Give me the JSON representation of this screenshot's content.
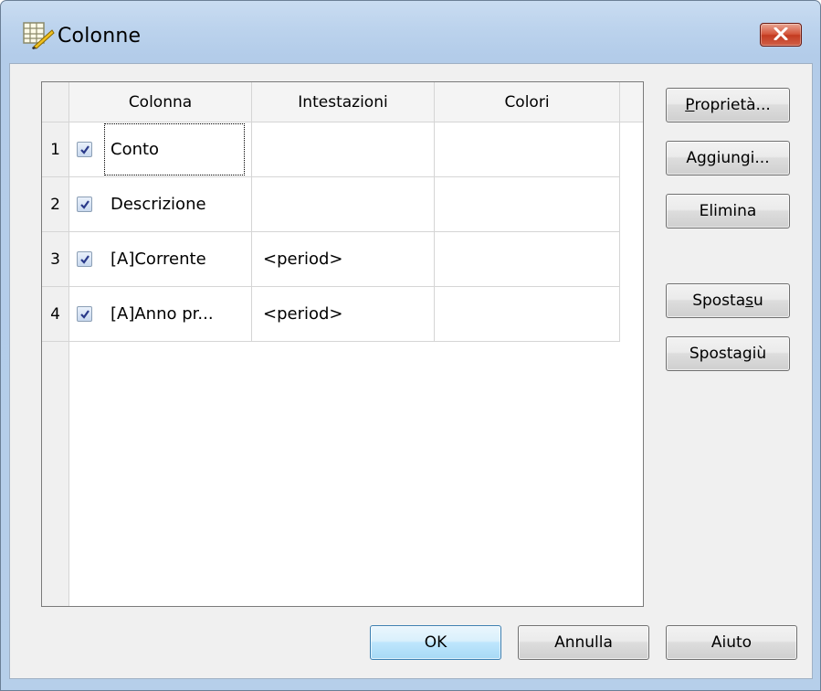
{
  "window": {
    "title": "Colonne"
  },
  "icons": {
    "app": "columns-app-icon",
    "close": "close-icon",
    "check": "checkmark-icon"
  },
  "grid": {
    "columns": [
      "Colonna",
      "Intestazioni",
      "Colori"
    ],
    "rows": [
      {
        "num": "1",
        "checked": true,
        "colonna": "Conto",
        "intestazioni": "",
        "colori": ""
      },
      {
        "num": "2",
        "checked": true,
        "colonna": "Descrizione",
        "intestazioni": "",
        "colori": ""
      },
      {
        "num": "3",
        "checked": true,
        "colonna": "[A]Corrente",
        "intestazioni": "<period>",
        "colori": ""
      },
      {
        "num": "4",
        "checked": true,
        "colonna": "[A]Anno pr...",
        "intestazioni": "<period>",
        "colori": ""
      }
    ]
  },
  "buttons": {
    "proprieta": {
      "pre": "",
      "mnemonic": "P",
      "post": "roprietà..."
    },
    "aggiungi": "Aggiungi...",
    "elimina": "Elimina",
    "sposta_su": {
      "pre": "Sposta ",
      "mnemonic": "s",
      "post": "u"
    },
    "sposta_giu": {
      "pre": "Sposta ",
      "mnemonic": "g",
      "post": "iù"
    },
    "ok": "OK",
    "annulla": "Annulla",
    "aiuto": "Aiuto"
  },
  "colors": {
    "titlebar": "#bcd3ed",
    "client": "#f0f0f0",
    "close": "#c43b20",
    "default_button_border": "#3c7fb1"
  }
}
